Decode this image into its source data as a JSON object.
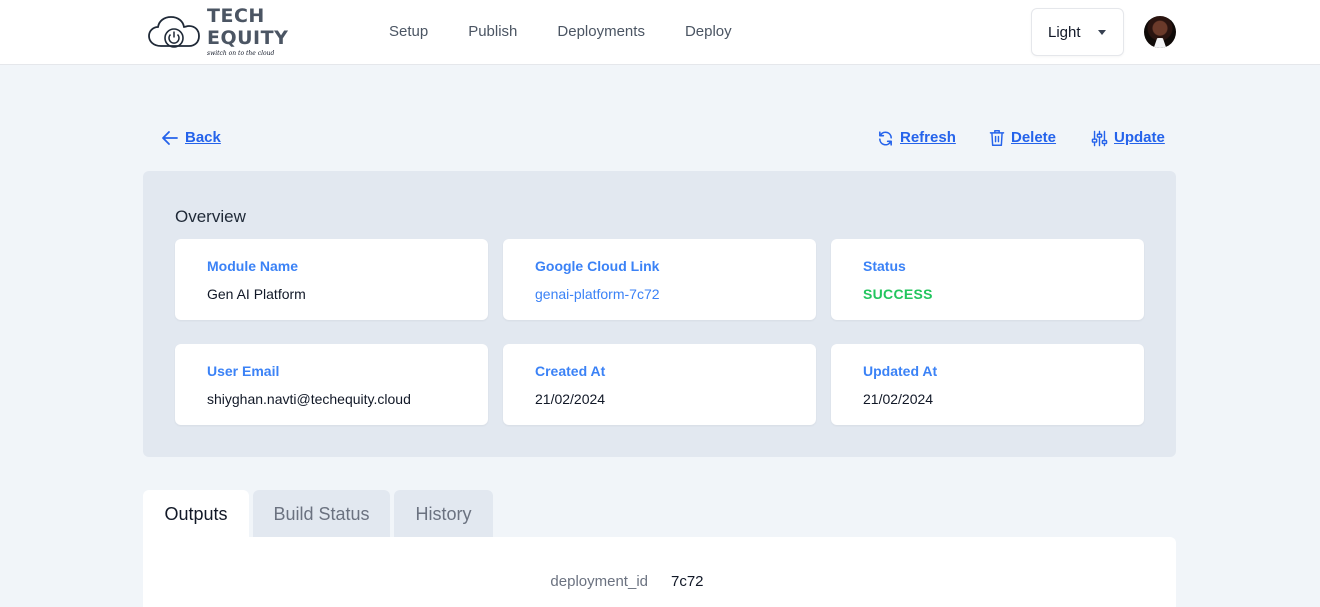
{
  "header": {
    "logo": {
      "title": "TECH EQUITY",
      "tagline": "switch on to the cloud"
    },
    "nav": [
      {
        "label": "Setup"
      },
      {
        "label": "Publish"
      },
      {
        "label": "Deployments"
      },
      {
        "label": "Deploy"
      }
    ],
    "theme_select": {
      "value": "Light"
    }
  },
  "actions": {
    "back": "Back",
    "refresh": "Refresh",
    "delete": "Delete",
    "update": "Update"
  },
  "overview": {
    "title": "Overview",
    "cards": [
      {
        "label": "Module Name",
        "value": "Gen AI Platform"
      },
      {
        "label": "Google Cloud Link",
        "value": "genai-platform-7c72"
      },
      {
        "label": "Status",
        "value": "SUCCESS"
      },
      {
        "label": "User Email",
        "value": "shiyghan.navti@techequity.cloud"
      },
      {
        "label": "Created At",
        "value": "21/02/2024"
      },
      {
        "label": "Updated At",
        "value": "21/02/2024"
      }
    ]
  },
  "tabs": [
    {
      "label": "Outputs",
      "active": true
    },
    {
      "label": "Build Status",
      "active": false
    },
    {
      "label": "History",
      "active": false
    }
  ],
  "outputs": [
    {
      "key": "deployment_id",
      "value": "7c72"
    }
  ],
  "colors": {
    "accent": "#2563eb",
    "label_blue": "#3b82f6",
    "success": "#22c55e",
    "page_bg": "#f1f5f9",
    "overview_bg": "#e2e8f0"
  },
  "icons": {
    "logo": "cloud-power-icon",
    "back": "arrow-left-icon",
    "refresh": "refresh-icon",
    "delete": "trash-icon",
    "update": "sliders-icon",
    "theme_caret": "caret-down-icon"
  }
}
